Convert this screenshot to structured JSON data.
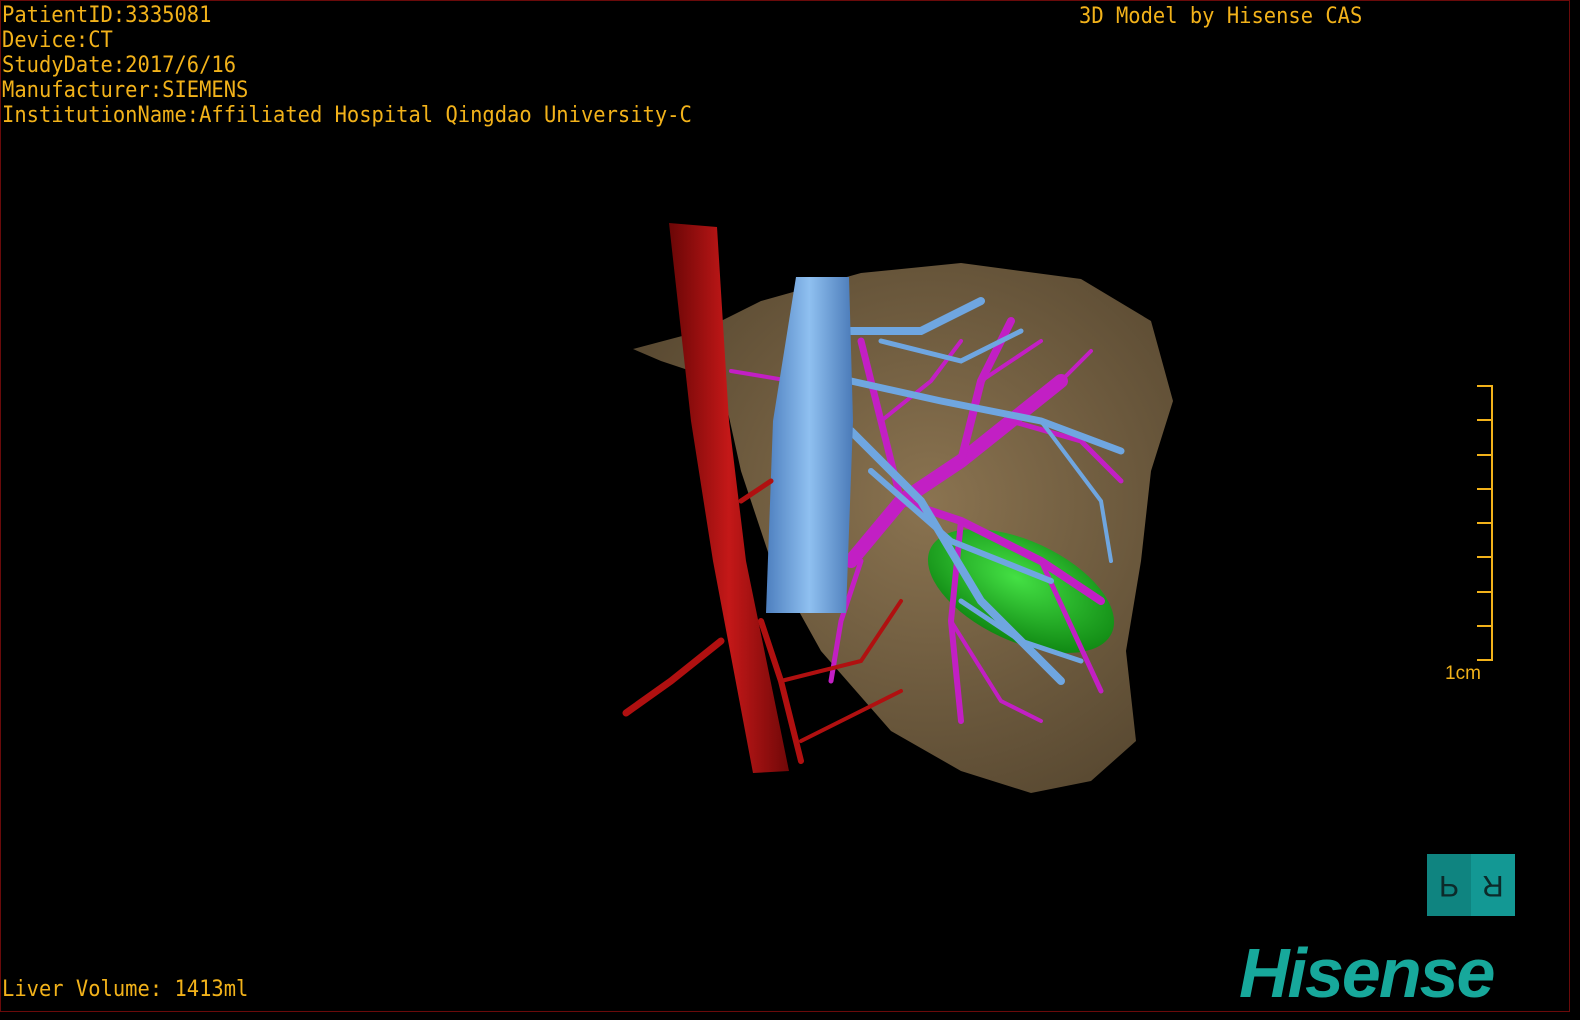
{
  "info": {
    "patient_id": "PatientID:3335081",
    "device": "Device:CT",
    "study_date": "StudyDate:2017/6/16",
    "manufacturer": "Manufacturer:SIEMENS",
    "institution": "InstitutionName:Affiliated Hospital Qingdao University-C"
  },
  "credit": "3D Model by Hisense CAS",
  "liver_volume": "Liver Volume: 1413ml",
  "scale": {
    "label": "1cm",
    "ticks": 9
  },
  "orientation_cube": {
    "left_face": "P",
    "right_face": "R"
  },
  "logo": "Hisense",
  "colors": {
    "text": "#f2b21a",
    "liver": "#7a6444",
    "portal_vein": "#6fa6e0",
    "hepatic_vein": "#c21fc4",
    "artery_aorta": "#b01010",
    "tumor": "#19b21c",
    "logo": "#17a89b"
  }
}
